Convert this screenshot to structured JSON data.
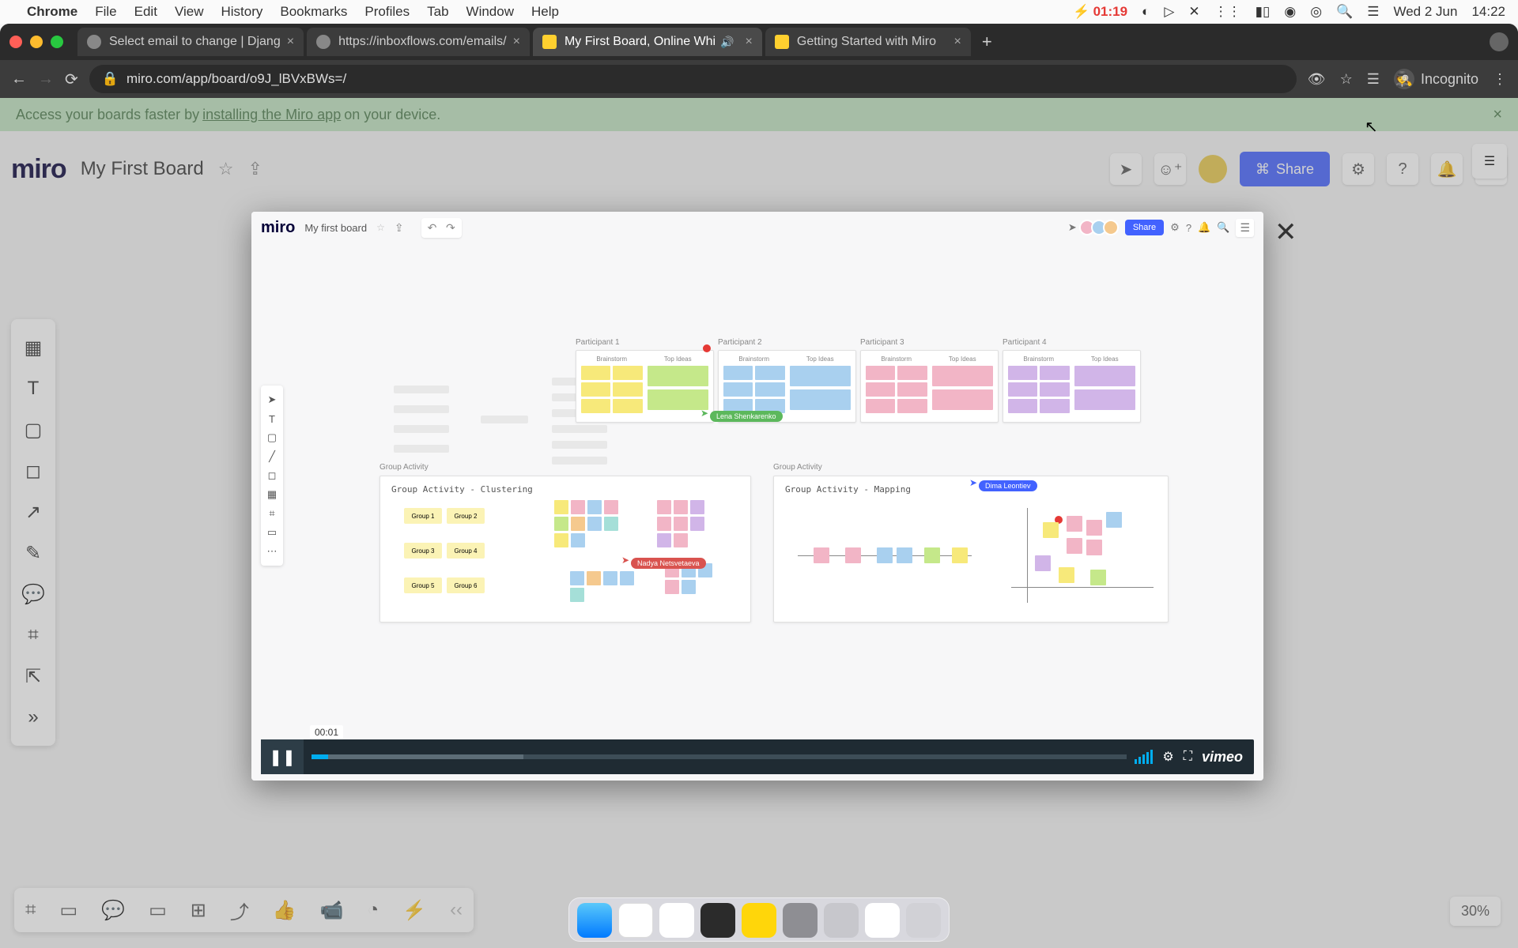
{
  "menubar": {
    "app": "Chrome",
    "items": [
      "File",
      "Edit",
      "View",
      "History",
      "Bookmarks",
      "Profiles",
      "Tab",
      "Window",
      "Help"
    ],
    "battery_time": "01:19",
    "date": "Wed 2 Jun",
    "time": "14:22"
  },
  "chrome": {
    "tabs": [
      {
        "title": "Select email to change | Djang"
      },
      {
        "title": "https://inboxflows.com/emails/"
      },
      {
        "title": "My First Board, Online Whi",
        "audio": true,
        "active": true
      },
      {
        "title": "Getting Started with Miro"
      }
    ],
    "url": "miro.com/app/board/o9J_lBVxBWs=/",
    "incognito": "Incognito"
  },
  "banner": {
    "prefix": "Access your boards faster by ",
    "link": "installing the Miro app",
    "suffix": " on your device."
  },
  "miro": {
    "logo": "miro",
    "board_title": "My First Board",
    "share": "Share",
    "zoom": "30%"
  },
  "video": {
    "header": {
      "logo": "miro",
      "title": "My first board",
      "share": "Share"
    },
    "participants": [
      {
        "label": "Participant 1",
        "col1": "Brainstorm",
        "col2": "Top Ideas",
        "theme": "yellow-green"
      },
      {
        "label": "Participant 2",
        "col1": "Brainstorm",
        "col2": "Top Ideas",
        "theme": "blue"
      },
      {
        "label": "Participant 3",
        "col1": "Brainstorm",
        "col2": "Top Ideas",
        "theme": "pink"
      },
      {
        "label": "Participant 4",
        "col1": "Brainstorm",
        "col2": "Top Ideas",
        "theme": "purple"
      }
    ],
    "cursors": {
      "green": "Lena Shenkarenko",
      "red": "Nadya Netsvetaeva",
      "blue": "Dima Leontiev"
    },
    "group_activity_label": "Group Activity",
    "clustering_title": "Group Activity - Clustering",
    "mapping_title": "Group Activity - Mapping",
    "groups": [
      "Group 1",
      "Group 2",
      "Group 3",
      "Group 4",
      "Group 5",
      "Group 6"
    ],
    "controls": {
      "time": "00:01",
      "provider": "vimeo"
    }
  }
}
